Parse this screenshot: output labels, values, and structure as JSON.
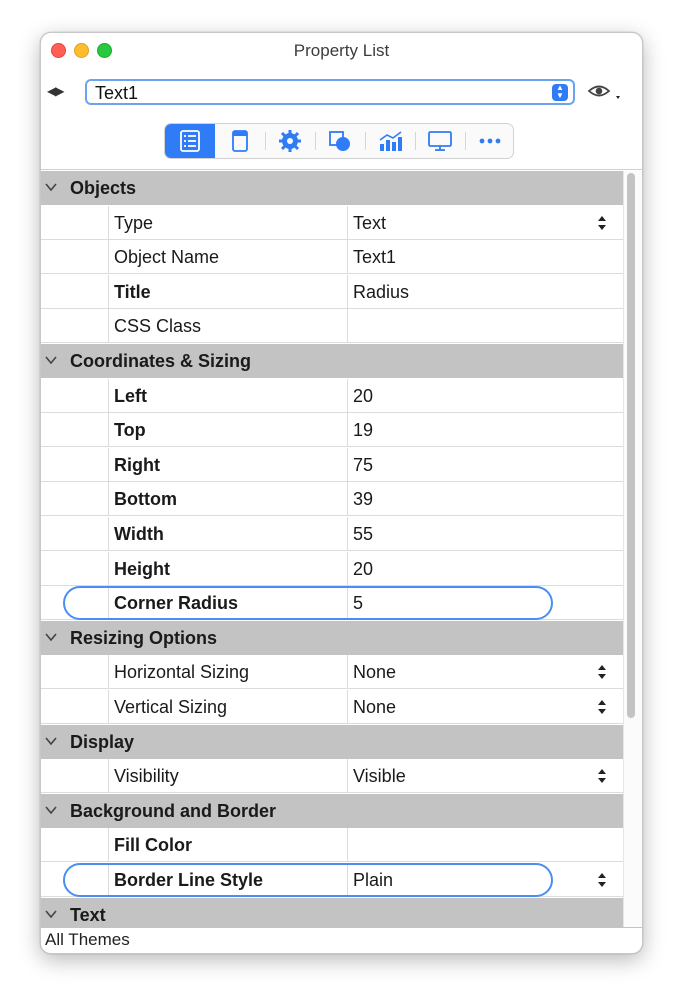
{
  "window": {
    "title": "Property List"
  },
  "header": {
    "object_select_value": "Text1"
  },
  "toolbar": {
    "buttons": [
      {
        "name": "properties",
        "icon": "property-list-icon",
        "active": true
      },
      {
        "name": "content",
        "icon": "document-icon"
      },
      {
        "name": "behaviors",
        "icon": "gear-icon"
      },
      {
        "name": "geometry",
        "icon": "shape-icon"
      },
      {
        "name": "charts",
        "icon": "chart-icon"
      },
      {
        "name": "display",
        "icon": "monitor-icon"
      },
      {
        "name": "more",
        "icon": "more-icon"
      }
    ]
  },
  "sections": {
    "objects": {
      "label": "Objects",
      "rows": [
        {
          "name": "Type",
          "value": "Text"
        },
        {
          "name": "Object Name",
          "value": "Text1"
        },
        {
          "name": "Title",
          "value": "Radius"
        },
        {
          "name": "CSS Class",
          "value": ""
        }
      ]
    },
    "coords": {
      "label": "Coordinates & Sizing",
      "rows": [
        {
          "name": "Left",
          "value": "20"
        },
        {
          "name": "Top",
          "value": "19"
        },
        {
          "name": "Right",
          "value": "75"
        },
        {
          "name": "Bottom",
          "value": "39"
        },
        {
          "name": "Width",
          "value": "55"
        },
        {
          "name": "Height",
          "value": "20"
        },
        {
          "name": "Corner Radius",
          "value": "5"
        }
      ]
    },
    "resizing": {
      "label": "Resizing Options",
      "rows": [
        {
          "name": "Horizontal Sizing",
          "value": "None"
        },
        {
          "name": "Vertical Sizing",
          "value": "None"
        }
      ]
    },
    "display": {
      "label": "Display",
      "rows": [
        {
          "name": "Visibility",
          "value": "Visible"
        }
      ]
    },
    "background": {
      "label": "Background and Border",
      "rows": [
        {
          "name": "Fill Color",
          "value": ""
        },
        {
          "name": "Border Line Style",
          "value": "Plain"
        }
      ]
    },
    "text": {
      "label": "Text"
    }
  },
  "footer": {
    "label": "All Themes"
  },
  "colors": {
    "accent": "#2f7cf6",
    "section_bg": "#c3c3c3",
    "highlight": "#4a8ef2"
  }
}
